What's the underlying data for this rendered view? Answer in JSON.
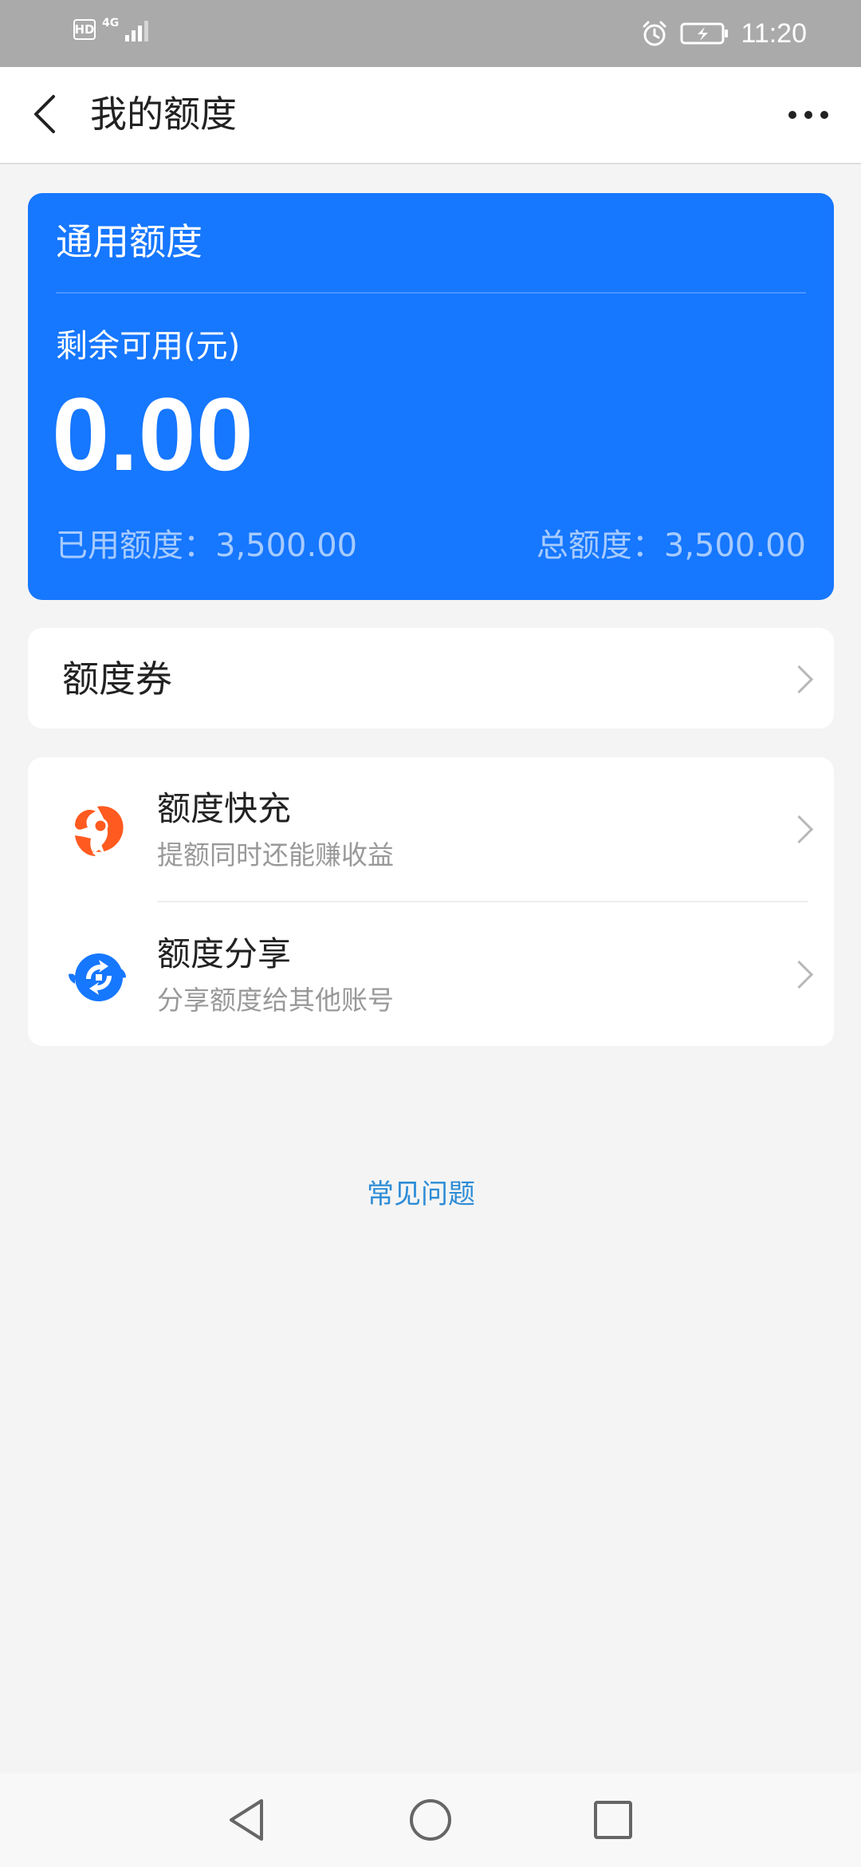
{
  "status_bar": {
    "hd": "HD",
    "network": "4G",
    "time": "11:20"
  },
  "header": {
    "title": "我的额度"
  },
  "quota_card": {
    "title": "通用额度",
    "remaining_label": "剩余可用(元)",
    "remaining_value": "0.00",
    "used_text": "已用额度：3,500.00",
    "total_text": "总额度：3,500.00"
  },
  "coupon": {
    "label": "额度券"
  },
  "actions": [
    {
      "title": "额度快充",
      "subtitle": "提额同时还能赚收益",
      "icon": "quick-charge-icon",
      "icon_color": "#ff5a1f"
    },
    {
      "title": "额度分享",
      "subtitle": "分享额度给其他账号",
      "icon": "share-icon",
      "icon_color": "#1677ff"
    }
  ],
  "faq": {
    "label": "常见问题"
  },
  "colors": {
    "card_blue": "#1677ff",
    "link_blue": "#2d8cd6",
    "background": "#f4f4f4"
  }
}
